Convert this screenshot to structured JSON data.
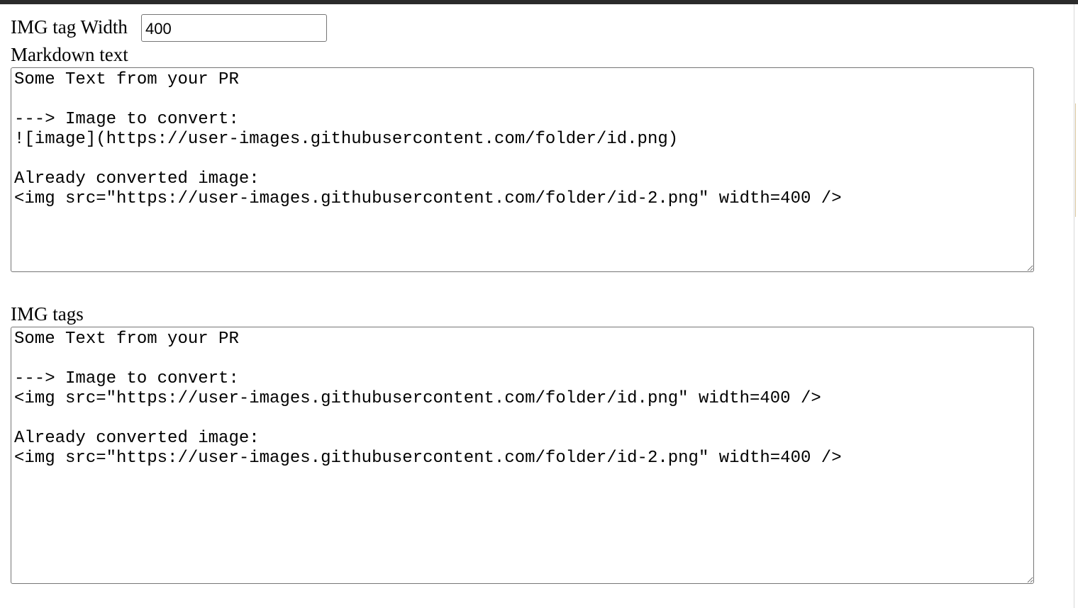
{
  "form": {
    "width_label": "IMG tag Width",
    "width_value": "400",
    "markdown_label": "Markdown text",
    "markdown_value": "Some Text from your PR\n\n---> Image to convert:\n![image](https://user-images.githubusercontent.com/folder/id.png)\n\nAlready converted image:\n<img src=\"https://user-images.githubusercontent.com/folder/id-2.png\" width=400 />",
    "img_tags_label": "IMG tags",
    "img_tags_value": "Some Text from your PR\n\n---> Image to convert:\n<img src=\"https://user-images.githubusercontent.com/folder/id.png\" width=400 />\n\nAlready converted image:\n<img src=\"https://user-images.githubusercontent.com/folder/id-2.png\" width=400 />"
  },
  "colors": {
    "top_bar": "#2b2b2b",
    "border": "#767676",
    "background": "#ffffff"
  }
}
